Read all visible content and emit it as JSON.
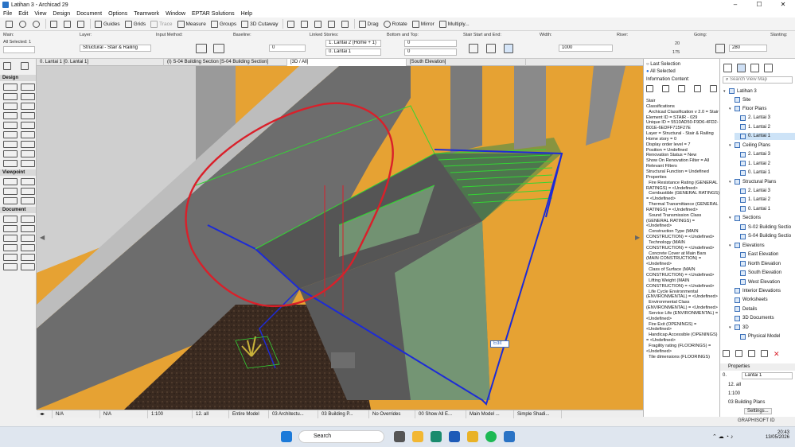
{
  "window": {
    "title": "Latihan 3 - Archicad 29"
  },
  "menu": [
    "File",
    "Edit",
    "View",
    "Design",
    "Document",
    "Options",
    "Teamwork",
    "Window",
    "EPTAR Solutions",
    "Help"
  ],
  "toolbar": {
    "guides": "Guides",
    "grids": "Grids",
    "trace": "Trace",
    "measure": "Measure",
    "groups": "Groups",
    "cutaway": "3D Cutaway",
    "drag": "Drag",
    "rotate": "Rotate",
    "mirror": "Mirror",
    "multiply": "Multiply..."
  },
  "infobox": {
    "main_label": "Main:",
    "all_selected": "All Selected: 1",
    "layer_label": "Layer:",
    "layer_value": "Structural - Stair & Railing",
    "input_label": "Input Method:",
    "baseline_label": "Baseline:",
    "baseline_value": "0",
    "linked_label": "Linked Stories:",
    "linked_top": "1. Lantai 2 (Home + 1)",
    "linked_bottom": "0. Lantai 1",
    "bt_label": "Bottom and Top:",
    "bt_top": "0",
    "bt_bottom": "0",
    "ss_label": "Stair Start and End:",
    "width_label": "Width:",
    "width_value": "1000",
    "riser_label": "Riser:",
    "riser_count": "20",
    "riser_height": "175",
    "going_label": "Going:",
    "going_value": "280",
    "slanting_label": "Slanting:"
  },
  "tabs": [
    "0. Lantai 1 [0. Lantai 1]",
    "(I) S-04 Building Section [S-04 Building Section]",
    "[3D / All]",
    "[South Elevation]"
  ],
  "toolbox": {
    "design": "Design",
    "viewpoint": "Viewpoint",
    "document": "Document"
  },
  "viewport": {
    "edit_label": "Edit"
  },
  "statusbar": [
    "N/A",
    "N/A",
    "1:100",
    "12. all",
    "Entire Model",
    "03 Architectu...",
    "03 Building P...",
    "No Overrides",
    "00 Show All E...",
    "Main Model ...",
    "Simple Shadi..."
  ],
  "info_panel": {
    "last_selection": "Last Selection",
    "all_selected": "All Selected",
    "content_label": "Information Content:",
    "text": "Stair\nClassifications\n  Archicad Classification v 2.0 = Stair\nElement ID = STAIR - 029\nUnique ID = 5510AD50-F9D6-4FD2-B01E-6EDFF715F27E\nLayer = Structural - Stair & Railing\nHome story = 0\nDisplay order level = 7\nPosition = Undefined\nRenovation Status = New\nShow On Renovation Filter = All Relevant Filters\nStructural Function = Undefined\nProperties\n  Fire Resistance Rating (GENERAL RATINGS) = <Undefined>\n  Combustible (GENERAL RATINGS) = <Undefined>\n  Thermal Transmittance (GENERAL RATINGS) = <Undefined>\n  Sound Transmission Class (GENERAL RATINGS) = <Undefined>\n  Construction Type (MAIN CONSTRUCTION) = <Undefined>\n  Technology (MAIN CONSTRUCTION) = <Undefined>\n  Concrete Cover at Main Bars (MAIN CONSTRUCTION) = <Undefined>\n  Class of Surface (MAIN CONSTRUCTION) = <Undefined>\n  Lifting Weight (MAIN CONSTRUCTION) = <Undefined>\n  Life Cycle Environmental (ENVIRONMENTAL) = <Undefined>\n  Environmental Class (ENVIRONMENTAL) = <Undefined>\n  Service Life (ENVIRONMENTAL) = <Undefined>\n  Fire Exit (OPENINGS) = <Undefined>\n  Handicap Accessible (OPENINGS) = <Undefined>\n  Fragility rating (FLOORINGS) = <Undefined>\n  Tile dimensions (FLOORINGS)"
  },
  "navigator": {
    "search_placeholder": "Search View Map",
    "project": "Latihan 3",
    "items": [
      "Site",
      "Floor Plans",
      "2. Lantai 3",
      "1. Lantai 2",
      "0. Lantai 1",
      "Ceiling Plans",
      "2. Lantai 3",
      "1. Lantai 2",
      "0. Lantai 1",
      "Structural Plans",
      "2. Lantai 3",
      "1. Lantai 2",
      "0. Lantai 1",
      "Sections",
      "S-02 Building Sectio",
      "S-04 Building Sectio",
      "Elevations",
      "East Elevation",
      "North Elevation",
      "South Elevation",
      "West Elevation",
      "Interior Elevations",
      "Worksheets",
      "Details",
      "3D Documents",
      "3D",
      "Physical Model"
    ],
    "properties_label": "Properties",
    "prop_story_num": "0.",
    "prop_story_name": "Lantai 1",
    "prop_layer_combo": "12. all",
    "prop_scale": "1:100",
    "prop_pen_set": "03 Building Plans",
    "settings_button": "Settings...",
    "brand": "GRAPHISOFT ID"
  },
  "taskbar": {
    "search": "Search",
    "time": "20:43",
    "date": "13/05/2026"
  },
  "colors": {
    "background_orange": "#e6a233",
    "selection_blue": "#1d2bd6",
    "selection_green": "#33d633",
    "markup_red": "#d9202a"
  }
}
